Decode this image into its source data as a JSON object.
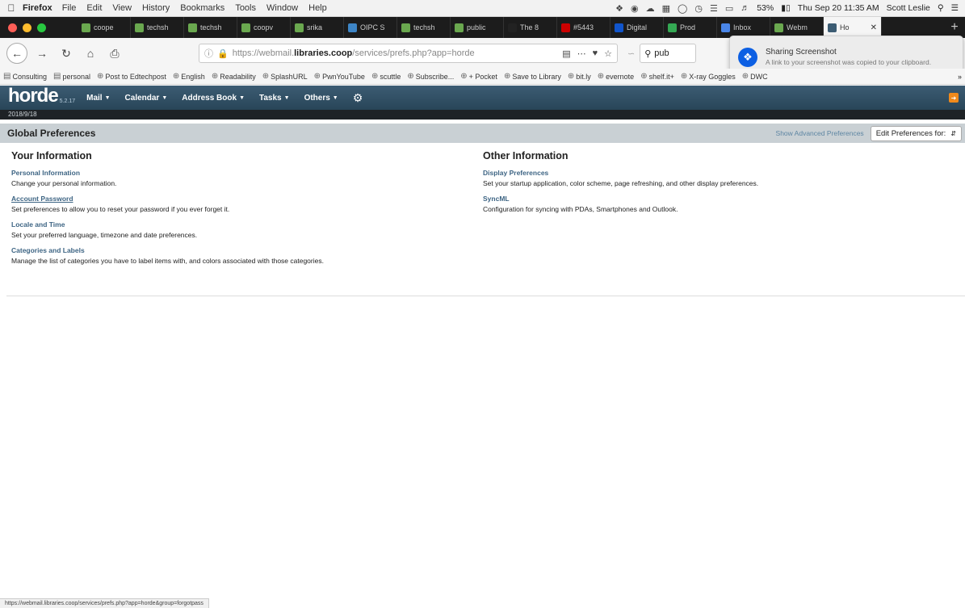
{
  "menubar": {
    "app": "Firefox",
    "items": [
      "File",
      "Edit",
      "View",
      "History",
      "Bookmarks",
      "Tools",
      "Window",
      "Help"
    ],
    "battery": "53%",
    "datetime": "Thu Sep 20  11:35 AM",
    "user": "Scott Leslie"
  },
  "tabs": [
    {
      "label": "coope",
      "color": "#6aa84f"
    },
    {
      "label": "techsh",
      "color": "#6aa84f"
    },
    {
      "label": "techsh",
      "color": "#6aa84f"
    },
    {
      "label": "coopv",
      "color": "#6aa84f"
    },
    {
      "label": "srika",
      "color": "#6aa84f"
    },
    {
      "label": "OIPC S",
      "color": "#3d85c6"
    },
    {
      "label": "techsh",
      "color": "#6aa84f"
    },
    {
      "label": "public",
      "color": "#6aa84f"
    },
    {
      "label": "The 8",
      "color": "#222222"
    },
    {
      "label": "#5443",
      "color": "#cc0000"
    },
    {
      "label": "Digital",
      "color": "#1155cc"
    },
    {
      "label": "Prod",
      "color": "#34a853"
    },
    {
      "label": "Inbox",
      "color": "#4a86e8"
    },
    {
      "label": "Webm",
      "color": "#6aa84f"
    },
    {
      "label": "Ho",
      "color": "#3c5c73",
      "active": true
    }
  ],
  "nav": {
    "url_prefix": "https://webmail.",
    "url_host": "libraries.coop",
    "url_rest": "/services/prefs.php?app=horde",
    "search_value": "pub"
  },
  "notification": {
    "title": "Sharing Screenshot",
    "body": "A link to your screenshot was copied to your clipboard."
  },
  "bookmarks": [
    "Consulting",
    "personal",
    "Post to Edtechpost",
    "English",
    "Readability",
    "SplashURL",
    "PwnYouTube",
    "scuttle",
    "Subscribe...",
    "+ Pocket",
    "Save to Library",
    "bit.ly",
    "evernote",
    "shelf.it+",
    "X-ray Goggles",
    "DWC"
  ],
  "horde": {
    "logo": "horde",
    "version": "5.2.17",
    "menus": [
      "Mail",
      "Calendar",
      "Address Book",
      "Tasks",
      "Others"
    ],
    "date": "2018/9/18"
  },
  "prefs": {
    "title": "Global Preferences",
    "advanced_link": "Show Advanced Preferences",
    "edit_for": "Edit Preferences for:"
  },
  "your_info": {
    "heading": "Your Information",
    "items": [
      {
        "link": "Personal Information",
        "desc": "Change your personal information."
      },
      {
        "link": "Account Password",
        "desc": "Set preferences to allow you to reset your password if you ever forget it."
      },
      {
        "link": "Locale and Time",
        "desc": "Set your preferred language, timezone and date preferences."
      },
      {
        "link": "Categories and Labels",
        "desc": "Manage the list of categories you have to label items with, and colors associated with those categories."
      }
    ]
  },
  "other_info": {
    "heading": "Other Information",
    "items": [
      {
        "link": "Display Preferences",
        "desc": "Set your startup application, color scheme, page refreshing, and other display preferences."
      },
      {
        "link": "SyncML",
        "desc": "Configuration for syncing with PDAs, Smartphones and Outlook."
      }
    ]
  },
  "status_url": "https://webmail.libraries.coop/services/prefs.php?app=horde&group=forgotpass"
}
